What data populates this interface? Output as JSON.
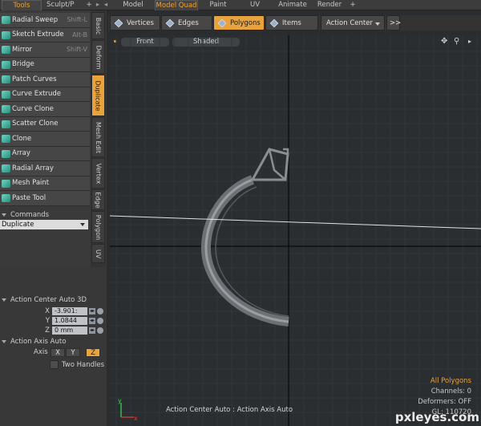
{
  "top_tabs": [
    {
      "label": "Tools",
      "active": true
    },
    {
      "label": "Sculpt/P",
      "active": false
    },
    {
      "label": "+",
      "active": false
    },
    {
      "label": "Model",
      "active": false
    },
    {
      "label": "Model Quad",
      "active": true
    },
    {
      "label": "Paint",
      "active": false
    },
    {
      "label": "UV",
      "active": false
    },
    {
      "label": "Animate",
      "active": false
    },
    {
      "label": "Render",
      "active": false
    },
    {
      "label": "+",
      "active": false
    }
  ],
  "tools": [
    {
      "label": "Radial Sweep",
      "shortcut": "Shift-L"
    },
    {
      "label": "Sketch Extrude",
      "shortcut": "Alt-B"
    },
    {
      "label": "Mirror",
      "shortcut": "Shift-V"
    },
    {
      "label": "Bridge",
      "shortcut": ""
    },
    {
      "label": "Patch Curves",
      "shortcut": ""
    },
    {
      "label": "Curve Extrude",
      "shortcut": ""
    },
    {
      "label": "Curve Clone",
      "shortcut": ""
    },
    {
      "label": "Scatter Clone",
      "shortcut": ""
    },
    {
      "label": "Clone",
      "shortcut": ""
    },
    {
      "label": "Array",
      "shortcut": ""
    },
    {
      "label": "Radial Array",
      "shortcut": ""
    },
    {
      "label": "Mesh Paint",
      "shortcut": ""
    },
    {
      "label": "Paste Tool",
      "shortcut": ""
    }
  ],
  "vertical_tabs": [
    "Basic",
    "Deform",
    "Duplicate",
    "Mesh Edit",
    "Vertex",
    "Edge",
    "Polygon",
    "UV"
  ],
  "commands": {
    "header": "Commands",
    "selected": "Duplicate"
  },
  "action_center": {
    "header": "Action Center Auto 3D",
    "x_label": "X",
    "x_value": "-3.901:",
    "y_label": "Y",
    "y_value": "1.0844",
    "z_label": "Z",
    "z_value": "0 mm"
  },
  "action_axis": {
    "header": "Action Axis Auto",
    "axis_label": "Axis",
    "buttons": [
      "X",
      "Y",
      "Z"
    ],
    "selected": "Z",
    "two_handles_label": "Two Handles"
  },
  "selection_bar": {
    "vertices": "Vertices",
    "edges": "Edges",
    "polygons": "Polygons",
    "items": "Items",
    "action_center": "Action Center",
    "more": ">>"
  },
  "viewport": {
    "view_label": "Front",
    "shading_label": "Shaded",
    "status": "Action Center Auto : Action Axis Auto"
  },
  "stats": {
    "mode": "All Polygons",
    "channels": "Channels: 0",
    "deformers": "Deformers: OFF",
    "gl": "GL: 110720"
  },
  "watermark": "pxleyes.com",
  "colors": {
    "accent": "#e8a33c",
    "icon_teal": "#4fb8a8"
  }
}
